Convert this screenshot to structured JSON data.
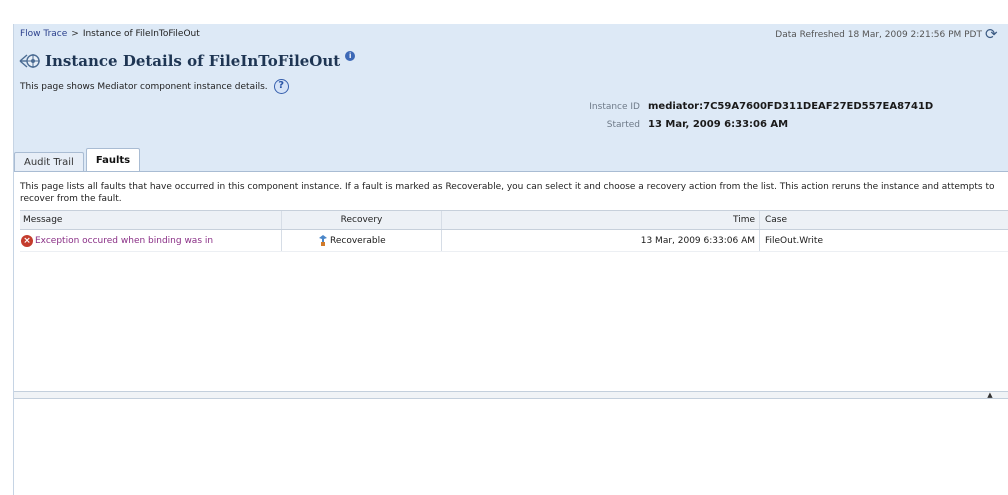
{
  "breadcrumb": {
    "items": [
      "Flow Trace",
      "Instance of FileInToFileOut"
    ],
    "separator": ">"
  },
  "refresh": {
    "text": "Data Refreshed 18 Mar, 2009 2:21:56 PM PDT"
  },
  "header": {
    "title": "Instance Details of FileInToFileOut",
    "description": "This page shows Mediator component instance details."
  },
  "instance": {
    "id_label": "Instance ID",
    "id_value": "mediator:7C59A7600FD311DEAF27ED557EA8741D",
    "started_label": "Started",
    "started_value": "13 Mar, 2009 6:33:06 AM"
  },
  "tabs": [
    {
      "label": "Audit Trail",
      "active": false
    },
    {
      "label": "Faults",
      "active": true
    }
  ],
  "faults": {
    "description": "This page lists all faults that have occurred in this component instance. If a fault is marked as Recoverable, you can select it and choose a recovery action from the list. This action reruns the instance and attempts to recover from the fault.",
    "columns": [
      "Message",
      "Recovery",
      "Time",
      "Case"
    ],
    "rows": [
      {
        "message": "Exception occured when binding was in",
        "recovery": "Recoverable",
        "time": "13 Mar, 2009 6:33:06 AM",
        "case": "FileOut.Write"
      }
    ]
  },
  "icons": {
    "title": "component-icon",
    "info": "info-icon",
    "help": "help-icon",
    "refresh": "refresh-icon",
    "error": "error-icon",
    "recover": "recovery-icon",
    "collapse": "collapse-up-icon"
  },
  "colors": {
    "header_bg": "#dde9f6",
    "link": "#2a3f8c",
    "fault_link": "#8a2f86",
    "error": "#c43c2d"
  }
}
